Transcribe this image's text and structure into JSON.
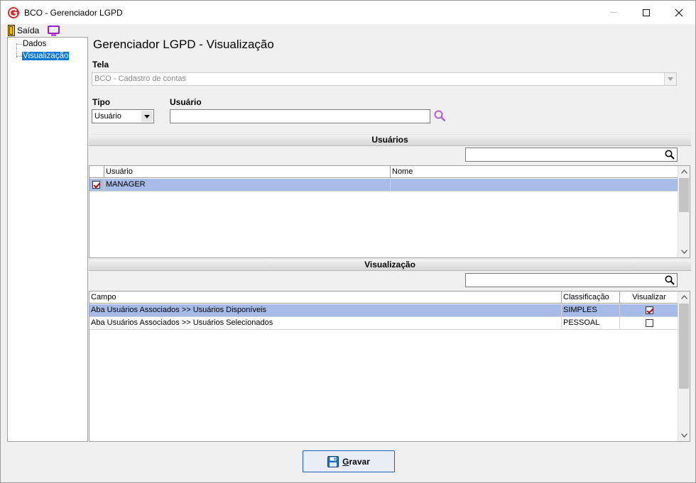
{
  "window": {
    "title": "BCO - Gerenciador LGPD"
  },
  "toolbar": {
    "exit_label": "Saída"
  },
  "tree": {
    "items": [
      {
        "label": "Dados"
      },
      {
        "label": "Visualização"
      }
    ]
  },
  "main": {
    "title": "Gerenciador LGPD - Visualização",
    "tela_label": "Tela",
    "tela_value": "BCO - Cadastro de contas",
    "tipo_label": "Tipo",
    "tipo_value": "Usuário",
    "usuario_label": "Usuário",
    "usuario_value": ""
  },
  "users_section": {
    "header": "Usuários",
    "search_value": "",
    "columns": [
      "Usuário",
      "Nome"
    ],
    "rows": [
      {
        "checked": true,
        "usuario": "MANAGER",
        "nome": ""
      }
    ]
  },
  "view_section": {
    "header": "Visualização",
    "search_value": "",
    "columns": [
      "Campo",
      "Classificação",
      "Visualizar"
    ],
    "rows": [
      {
        "campo": "Aba Usuários Associados >> Usuários Disponíveis",
        "classificacao": "SIMPLES",
        "visualizar": true
      },
      {
        "campo": "Aba Usuários Associados >> Usuários Selecionados",
        "classificacao": "PESSOAL",
        "visualizar": false
      }
    ]
  },
  "footer": {
    "save_first_letter": "G",
    "save_rest": "ravar"
  },
  "colors": {
    "accent": "#0078d7",
    "selected_row": "#a6bbe8",
    "check_mark": "#c00000",
    "logo": "#d42a2a",
    "monitor_icon": "#9b1fd0"
  }
}
